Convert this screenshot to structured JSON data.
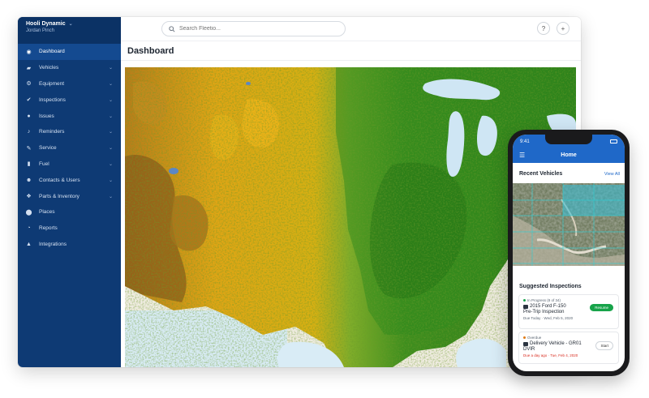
{
  "org": {
    "name": "Hooli Dynamic",
    "user": "Jordan Pinch"
  },
  "sidebar": {
    "items": [
      {
        "label": "Dashboard",
        "icon": "dashboard-icon",
        "active": true,
        "chevron": ""
      },
      {
        "label": "Vehicles",
        "icon": "car-icon",
        "chevron": "⌄"
      },
      {
        "label": "Equipment",
        "icon": "equipment-icon",
        "chevron": "⌄"
      },
      {
        "label": "Inspections",
        "icon": "check-circle-icon",
        "chevron": "⌄"
      },
      {
        "label": "Issues",
        "icon": "issue-icon",
        "chevron": "⌄"
      },
      {
        "label": "Reminders",
        "icon": "bell-icon",
        "chevron": "⌄"
      },
      {
        "label": "Service",
        "icon": "wrench-icon",
        "chevron": "⌄"
      },
      {
        "label": "Fuel",
        "icon": "fuel-icon",
        "chevron": "⌄"
      },
      {
        "label": "Contacts & Users",
        "icon": "users-icon",
        "chevron": "⌄"
      },
      {
        "label": "Parts & Inventory",
        "icon": "parts-icon",
        "chevron": "⌄"
      },
      {
        "label": "Places",
        "icon": "pin-icon",
        "chevron": ""
      },
      {
        "label": "Reports",
        "icon": "pie-icon",
        "chevron": ""
      },
      {
        "label": "Integrations",
        "icon": "integrations-icon",
        "chevron": ""
      }
    ]
  },
  "topbar": {
    "search_placeholder": "Search Fleetio...",
    "help": "?",
    "add": "+"
  },
  "page": {
    "title": "Dashboard"
  },
  "mobile": {
    "time": "9:41",
    "title": "Home",
    "recent_title": "Recent Vehicles",
    "view_all": "View All",
    "suggested_title": "Suggested Inspections",
    "cards": [
      {
        "status": "In Progress (8 of 34)",
        "status_color": "#17a34a",
        "vehicle": "2015 Ford F-150",
        "form": "Pre-Trip Inspection",
        "due": "Due Today · Wed, Feb 5, 2020",
        "due_color": "#5b6673",
        "action": "Resume"
      },
      {
        "status": "Overdue",
        "status_color": "#e07b16",
        "vehicle": "Delivery Vehicle - GR01",
        "form": "DVIR",
        "due": "Due a day ago · Tue, Feb 4, 2020",
        "due_color": "#d92d20",
        "action": "Start"
      }
    ]
  },
  "colors": {
    "sidebar": "#0e3a74",
    "accent": "#1f68c8",
    "success": "#17a34a"
  }
}
